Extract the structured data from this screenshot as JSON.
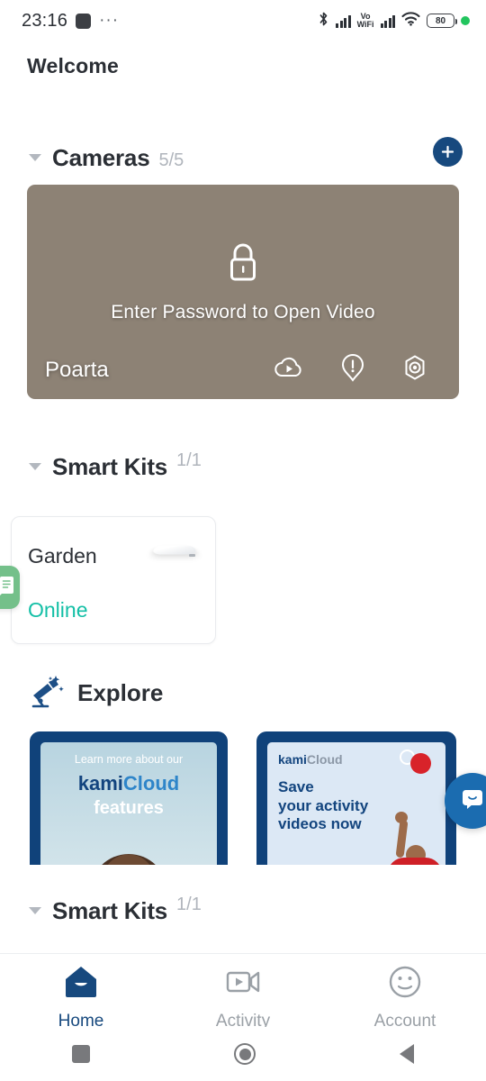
{
  "status_bar": {
    "time": "23:16",
    "dots": "···",
    "vowifi_top": "Vo",
    "vowifi_bottom": "WiFi",
    "battery_level": "80"
  },
  "header": {
    "welcome": "Welcome"
  },
  "cameras_section": {
    "title": "Cameras",
    "count": "5/5",
    "add_label": "+"
  },
  "camera_card": {
    "locked_message": "Enter Password to Open Video",
    "name": "Poarta",
    "icons": [
      "cloud-play-icon",
      "alert-icon",
      "settings-target-icon"
    ]
  },
  "smart_kits_section": {
    "title": "Smart Kits",
    "count": "1/1"
  },
  "smart_kit_card": {
    "name": "Garden",
    "status": "Online",
    "status_color": "#13bfa6"
  },
  "explore_section": {
    "title": "Explore",
    "cards": [
      {
        "line1": "Learn more about our",
        "brand_first": "kami",
        "brand_second": "Cloud",
        "line3": "features"
      },
      {
        "brand_first": "kami",
        "brand_second": "Cloud",
        "headline": "Save\nyour activity\nvideos now"
      }
    ]
  },
  "smart_kits_section_2": {
    "title": "Smart Kits",
    "count": "1/1"
  },
  "bottom_nav": {
    "items": [
      {
        "label": "Home",
        "icon": "house-icon",
        "active": true
      },
      {
        "label": "Activity",
        "icon": "video-camera-icon",
        "active": false
      },
      {
        "label": "Account",
        "icon": "face-icon",
        "active": false
      }
    ]
  },
  "android_nav": {
    "recents": "recents-square-icon",
    "home": "home-circle-icon",
    "back": "back-triangle-icon"
  },
  "colors": {
    "brand_navy": "#17497e",
    "teal": "#13bfa6",
    "chat_blue": "#1b6cb0",
    "widget_green": "#74c08a"
  }
}
